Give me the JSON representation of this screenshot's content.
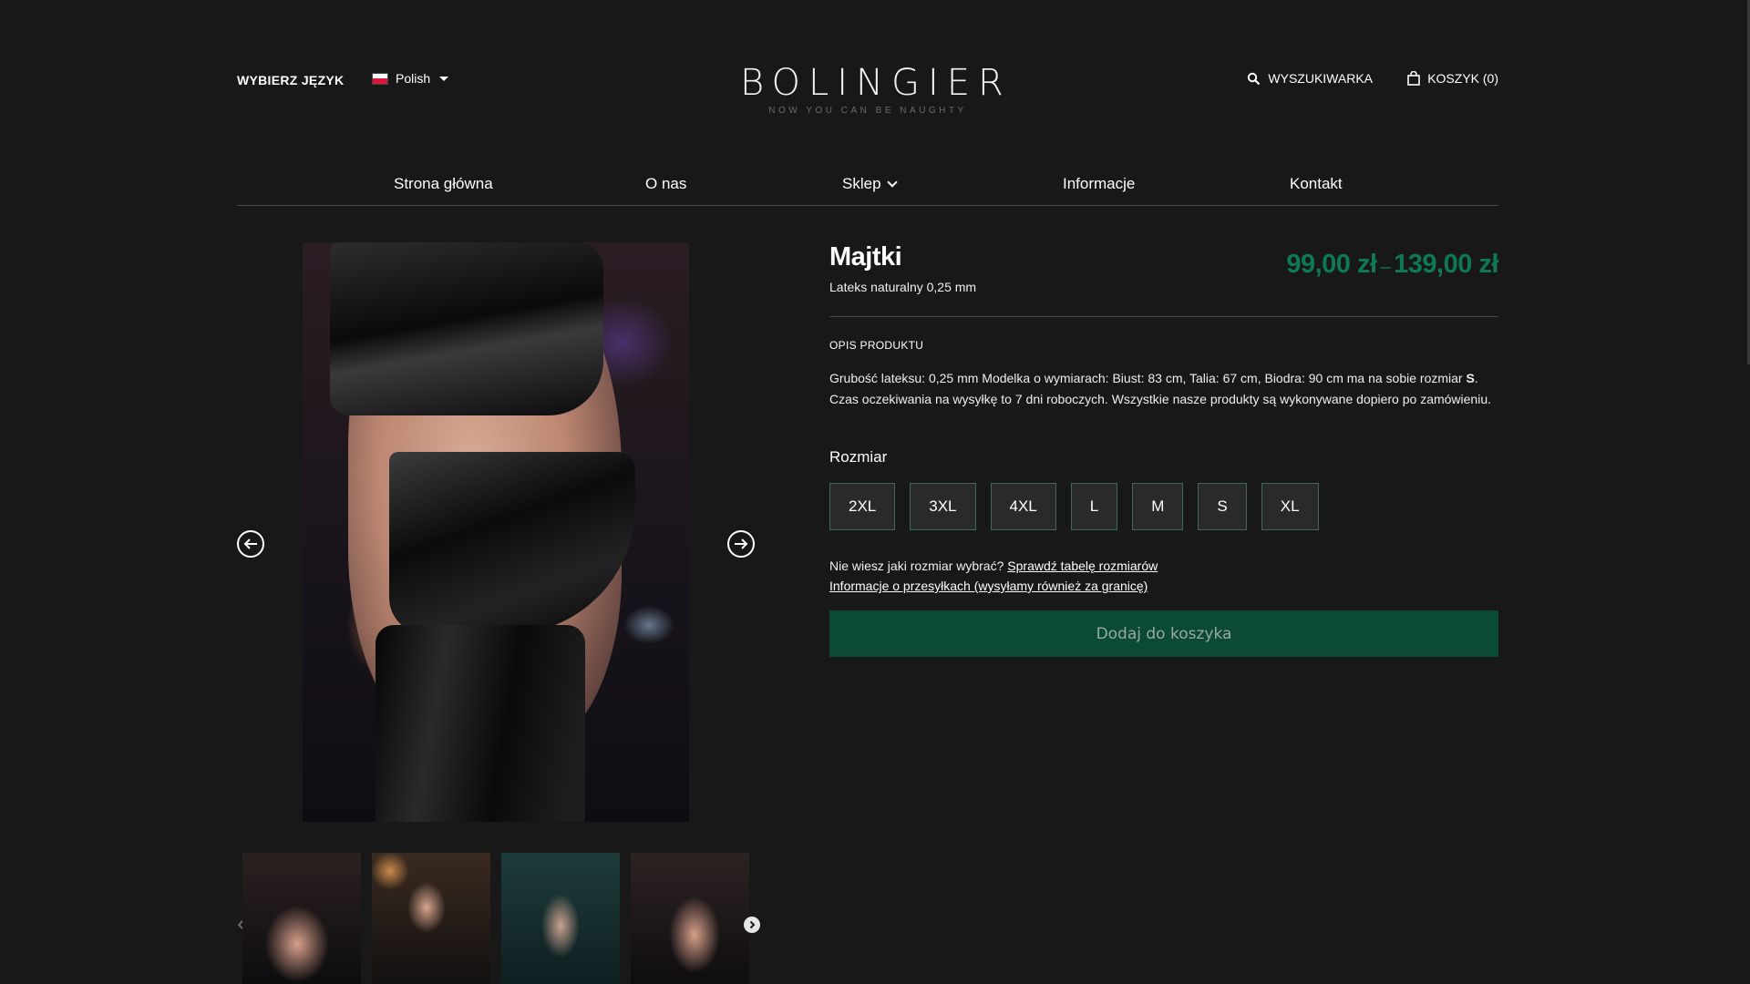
{
  "header": {
    "language_label": "WYBIERZ JĘZYK",
    "language_value": "Polish",
    "logo_title": "BOLINGIER",
    "logo_tagline": "NOW YOU CAN BE NAUGHTY",
    "search_label": "WYSZUKIWARKA",
    "cart_label": "KOSZYK (0)"
  },
  "nav": {
    "items": [
      {
        "label": "Strona główna"
      },
      {
        "label": "O nas"
      },
      {
        "label": "Sklep"
      },
      {
        "label": "Informacje"
      },
      {
        "label": "Kontakt"
      }
    ]
  },
  "product": {
    "title": "Majtki",
    "subtitle": "Lateks naturalny 0,25 mm",
    "price_from": "99,00 zł",
    "price_sep": "–",
    "price_to": "139,00 zł",
    "description_label": "OPIS PRODUKTU",
    "description_part1": "Grubość lateksu: 0,25 mm Modelka o wymiarach: Biust: 83 cm, Talia: 67 cm, Biodra: 90 cm ma na sobie rozmiar ",
    "description_size": "S",
    "description_part2": ". Czas oczekiwania na wysyłkę to 7 dni roboczych. Wszystkie nasze produkty są wykonywane dopiero po zamówieniu.",
    "size_label": "Rozmiar",
    "sizes": [
      "2XL",
      "3XL",
      "4XL",
      "L",
      "M",
      "S",
      "XL"
    ],
    "help_text": "Nie wiesz jaki rozmiar wybrać? ",
    "size_chart_link": "Sprawdź tabelę rozmiarów",
    "shipping_link": "Informacje o przesyłkach (wysyłamy również za granicę)",
    "add_to_cart": "Dodaj do koszyka"
  },
  "colors": {
    "background": "#181818",
    "price_green": "#0d7a55",
    "button_green": "#0a4a36"
  }
}
